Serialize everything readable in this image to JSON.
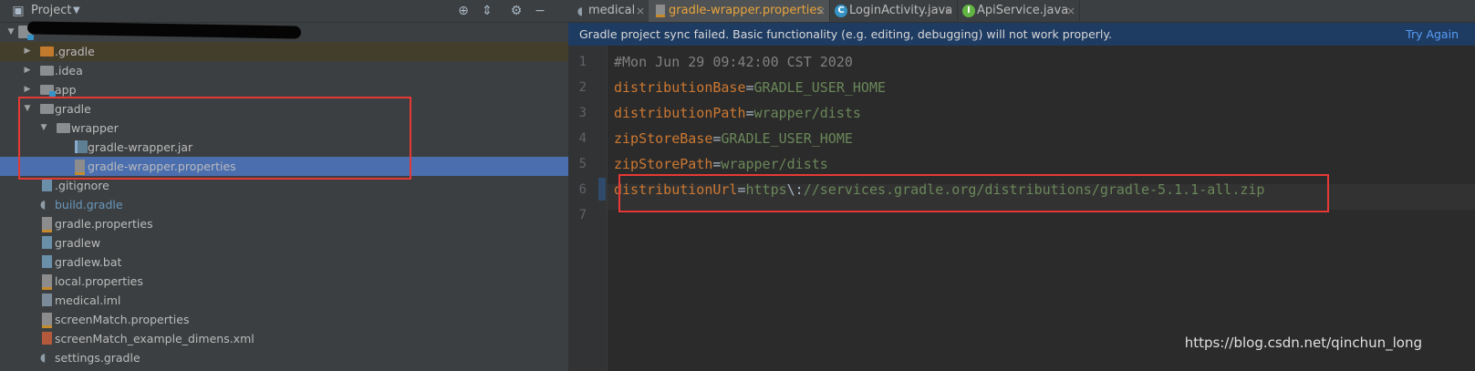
{
  "project_panel": {
    "title": "Project",
    "toolbar_icons": [
      "locate-icon",
      "collapse-icon",
      "gear-icon",
      "hide-icon"
    ]
  },
  "tree": [
    {
      "label": ".gradle",
      "depth": 1,
      "arrow": "collapsed",
      "icon": "folder-orange-icon"
    },
    {
      "label": ".idea",
      "depth": 1,
      "arrow": "collapsed",
      "icon": "folder-icon"
    },
    {
      "label": "app",
      "depth": 1,
      "arrow": "collapsed",
      "icon": "module-folder-icon"
    },
    {
      "label": "gradle",
      "depth": 1,
      "arrow": "expanded",
      "icon": "folder-icon"
    },
    {
      "label": "wrapper",
      "depth": 2,
      "arrow": "expanded",
      "icon": "folder-icon"
    },
    {
      "label": "gradle-wrapper.jar",
      "depth": 3,
      "arrow": "none",
      "icon": "jar-file-icon"
    },
    {
      "label": "gradle-wrapper.properties",
      "depth": 3,
      "arrow": "none",
      "icon": "properties-file-icon",
      "selected": true
    },
    {
      "label": ".gitignore",
      "depth": 1,
      "arrow": "none",
      "icon": "text-file-icon"
    },
    {
      "label": "build.gradle",
      "depth": 1,
      "arrow": "none",
      "icon": "gradle-elephant-icon",
      "color": "#6897bb"
    },
    {
      "label": "gradle.properties",
      "depth": 1,
      "arrow": "none",
      "icon": "properties-file-icon"
    },
    {
      "label": "gradlew",
      "depth": 1,
      "arrow": "none",
      "icon": "text-file-icon"
    },
    {
      "label": "gradlew.bat",
      "depth": 1,
      "arrow": "none",
      "icon": "text-file-icon"
    },
    {
      "label": "local.properties",
      "depth": 1,
      "arrow": "none",
      "icon": "properties-file-icon"
    },
    {
      "label": "medical.iml",
      "depth": 1,
      "arrow": "none",
      "icon": "iml-file-icon"
    },
    {
      "label": "screenMatch.properties",
      "depth": 1,
      "arrow": "none",
      "icon": "properties-file-icon"
    },
    {
      "label": "screenMatch_example_dimens.xml",
      "depth": 1,
      "arrow": "none",
      "icon": "xml-file-icon"
    },
    {
      "label": "settings.gradle",
      "depth": 1,
      "arrow": "none",
      "icon": "gradle-elephant-icon"
    }
  ],
  "tabs": [
    {
      "label": "medical",
      "icon": "gradle-elephant-icon",
      "close": "×"
    },
    {
      "label": "gradle-wrapper.properties",
      "icon": "properties-file-icon",
      "close": "×",
      "active": true
    },
    {
      "label": "LoginActivity.java",
      "icon": "class-c-icon",
      "close": "×"
    },
    {
      "label": "ApiService.java",
      "icon": "interface-i-icon",
      "close": "×"
    }
  ],
  "banner": {
    "message": "Gradle project sync failed. Basic functionality (e.g. editing, debugging) will not work properly.",
    "action": "Try Again"
  },
  "editor": {
    "line_numbers": [
      "1",
      "2",
      "3",
      "4",
      "5",
      "6",
      "7"
    ],
    "lines": [
      {
        "comment": "#Mon Jun 29 09:42:00 CST 2020"
      },
      {
        "key": "distributionBase",
        "eq": "=",
        "value": "GRADLE_USER_HOME"
      },
      {
        "key": "distributionPath",
        "eq": "=",
        "value": "wrapper/dists"
      },
      {
        "key": "zipStoreBase",
        "eq": "=",
        "value": "GRADLE_USER_HOME"
      },
      {
        "key": "zipStorePath",
        "eq": "=",
        "value": "wrapper/dists"
      },
      {
        "key": "distributionUrl",
        "eq": "=",
        "value_prefix": "https",
        "escape": "\\:",
        "value": "//services.gradle.org/distributions/gradle-5.1.1-all.zip"
      },
      {}
    ]
  },
  "colors": {
    "annotation": "#e53935",
    "selection": "#4b6eaf",
    "banner": "#1e3b62",
    "key": "#cc7832",
    "value": "#6a8759"
  },
  "watermark": "https://blog.csdn.net/qinchun_long"
}
